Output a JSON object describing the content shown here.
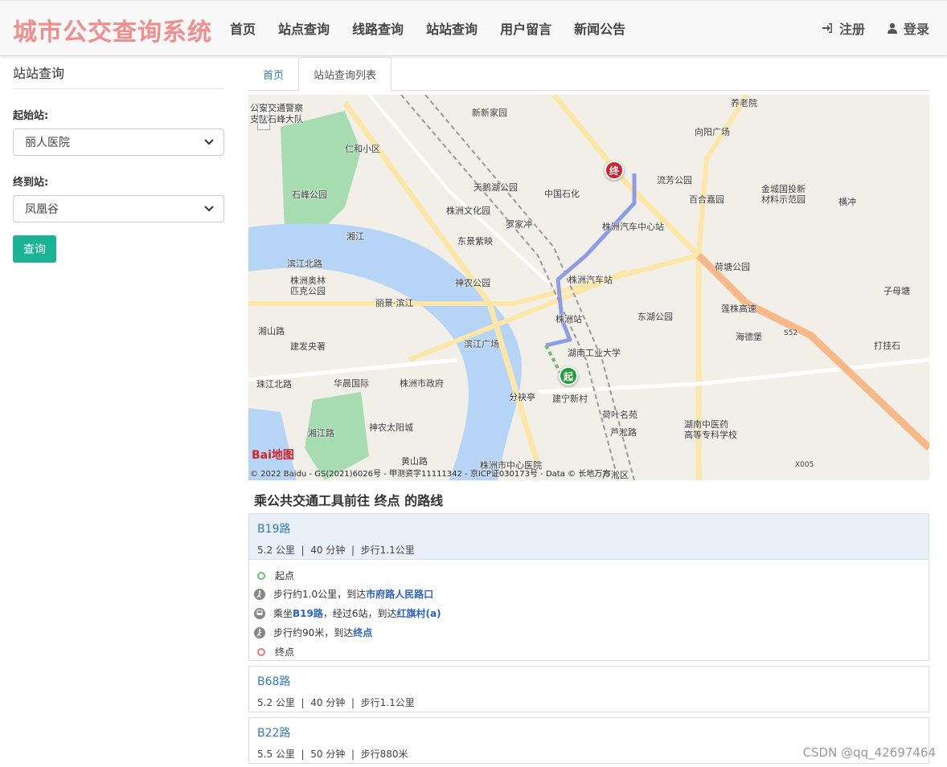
{
  "brand": "城市公交查询系统",
  "nav": [
    "首页",
    "站点查询",
    "线路查询",
    "站站查询",
    "用户留言",
    "新闻公告"
  ],
  "user_nav": {
    "register": "注册",
    "login": "登录"
  },
  "sidebar": {
    "title": "站站查询",
    "start_label": "起始站:",
    "start_value": "丽人医院",
    "end_label": "终到站:",
    "end_value": "凤凰谷",
    "query_button": "查询"
  },
  "tabs": {
    "home": "首页",
    "active": "站站查询列表"
  },
  "map": {
    "zoom_in": "+",
    "zoom_out": "−",
    "logo": "Bai地图",
    "copyright": "© 2022 Baidu - GS(2021)6026号 - 甲测资字11111342 - 京ICP证030173号 - Data © 长地万方",
    "start_marker": "起",
    "end_marker": "终",
    "labels": {
      "l1": "公安交通警察",
      "l2": "支队石峰大队",
      "l3": "新新家园",
      "l4": "养老院",
      "l5": "向阳广场",
      "l6": "仁和小区",
      "l7": "流芳公园",
      "l8": "天鹅湖公园",
      "l9": "中国石化",
      "l10": "百合嘉园",
      "l11": "金城国投新",
      "l12": "材料示范园",
      "l13": "横冲",
      "l14": "石峰公园",
      "l15": "株洲文化园",
      "l16": "罗家冲",
      "l17": "株洲汽车中心站",
      "l18": "湘江",
      "l19": "东景紫映",
      "l20": "荷塘公园",
      "l21": "滨江北路",
      "l22": "株洲奥林",
      "l23": "匹克公园",
      "l24": "神农公园",
      "l25": "株洲汽车站",
      "l26": "子母塘",
      "l27": "丽景·滨江",
      "l28": "莲株高速",
      "l29": "株洲站",
      "l30": "东湖公园",
      "l31": "湘山路",
      "l32": "建发央著",
      "l33": "滨江广场",
      "l34": "海德堡",
      "l35": "打挂石",
      "l36": "湖南工业大学",
      "l37": "珠江北路",
      "l38": "华晨国际",
      "l39": "株洲市政府",
      "l40": "分袂亭",
      "l41": "建宁新村",
      "l42": "荷叶名苑",
      "l43": "神农太阳城",
      "l44": "芦淞路",
      "l45": "湖南中医药",
      "l46": "高等专科学校",
      "l47": "黄山路",
      "l48": "株洲市中心医院",
      "l49": "芦淞区",
      "l50": "X005",
      "l51": "S52",
      "l52": "湘江路"
    }
  },
  "routes_heading": "乘公共交通工具前往 终点 的路线",
  "routes": [
    {
      "name": "B19路",
      "distance": "5.2 公里",
      "time": "40 分钟",
      "walk": "步行1.1公里"
    },
    {
      "name": "B68路",
      "distance": "5.2 公里",
      "time": "40 分钟",
      "walk": "步行1.1公里"
    },
    {
      "name": "B22路",
      "distance": "5.5 公里",
      "time": "50 分钟",
      "walk": "步行880米"
    }
  ],
  "steps": {
    "start": "起点",
    "walk1_prefix": "步行约1.0公里，到达",
    "walk1_target": "市府路人民路口",
    "bus_prefix": "乘坐",
    "bus_line": "B19路",
    "bus_mid": "，经过6站，到达",
    "bus_target": "红旗村(a)",
    "walk2_prefix": "步行约90米，到达",
    "walk2_target": "终点",
    "end": "终点"
  },
  "meta_sep": "|",
  "watermark": "CSDN @qq_42697464",
  "colors": {
    "brand": "#f28d8d",
    "accent": "#1ab394",
    "link": "#337ab7",
    "river": "#b6d4f5",
    "route": "#8e9ce8"
  }
}
